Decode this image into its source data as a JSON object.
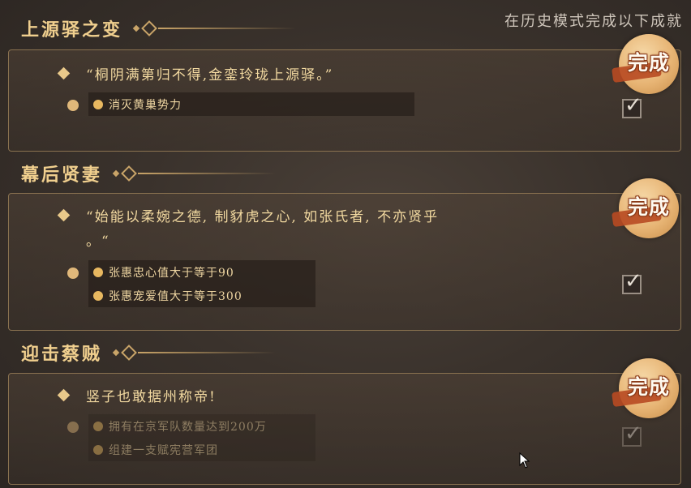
{
  "header": {
    "hint": "在历史模式完成以下成就"
  },
  "achievements": [
    {
      "title": "上源驿之变",
      "quote": "“桐阴满第归不得,金銮玲珑上源驿。”",
      "conditions": [
        "消灭黄巢势力"
      ],
      "status": "完成",
      "checked": true
    },
    {
      "title": "幕后贤妻",
      "quote_lines": [
        "“始能以柔婉之德, 制豺虎之心, 如张氏者, 不亦贤乎",
        "。“"
      ],
      "conditions": [
        "张惠忠心值大于等于90",
        "张惠宠爱值大于等于300"
      ],
      "status": "完成",
      "checked": true
    },
    {
      "title": "迎击蔡贼",
      "quote": "竖子也敢据州称帝!",
      "conditions": [
        "拥有在京军队数量达到200万",
        "组建一支赋宪营军团"
      ],
      "status": "完成",
      "checked": true
    }
  ],
  "icons": {
    "check": "check-icon",
    "cursor": "mouse-cursor-icon"
  },
  "colors": {
    "gold": "#e9c98a",
    "stamp": "#e7b474",
    "ribbon": "#b84a22"
  }
}
